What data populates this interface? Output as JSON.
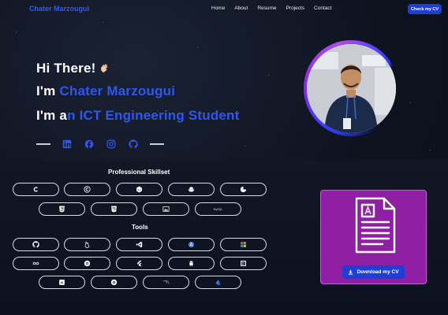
{
  "nav": {
    "brand": "Chater Marzougui",
    "items": [
      "Home",
      "About",
      "Resume",
      "Projects",
      "Contact"
    ],
    "cta": "Check my CV"
  },
  "hero": {
    "greeting": "Hi There!",
    "intro_prefix": "I'm ",
    "name": "Chater Marzougui",
    "role_prefix": "I'm a",
    "role_rest": "n ICT Engineering Student"
  },
  "skills": {
    "title": "Professional Skillset",
    "tools_title": "Tools",
    "mysql_text": "MySQL"
  },
  "cv_card": {
    "button_label": "Download my CV"
  },
  "icons": {
    "social": [
      "linkedin-icon",
      "facebook-icon",
      "instagram-icon",
      "github-icon"
    ]
  },
  "colors": {
    "accent": "#2f57f0",
    "button": "#1e3fd6",
    "card": "#8f1fa3"
  }
}
